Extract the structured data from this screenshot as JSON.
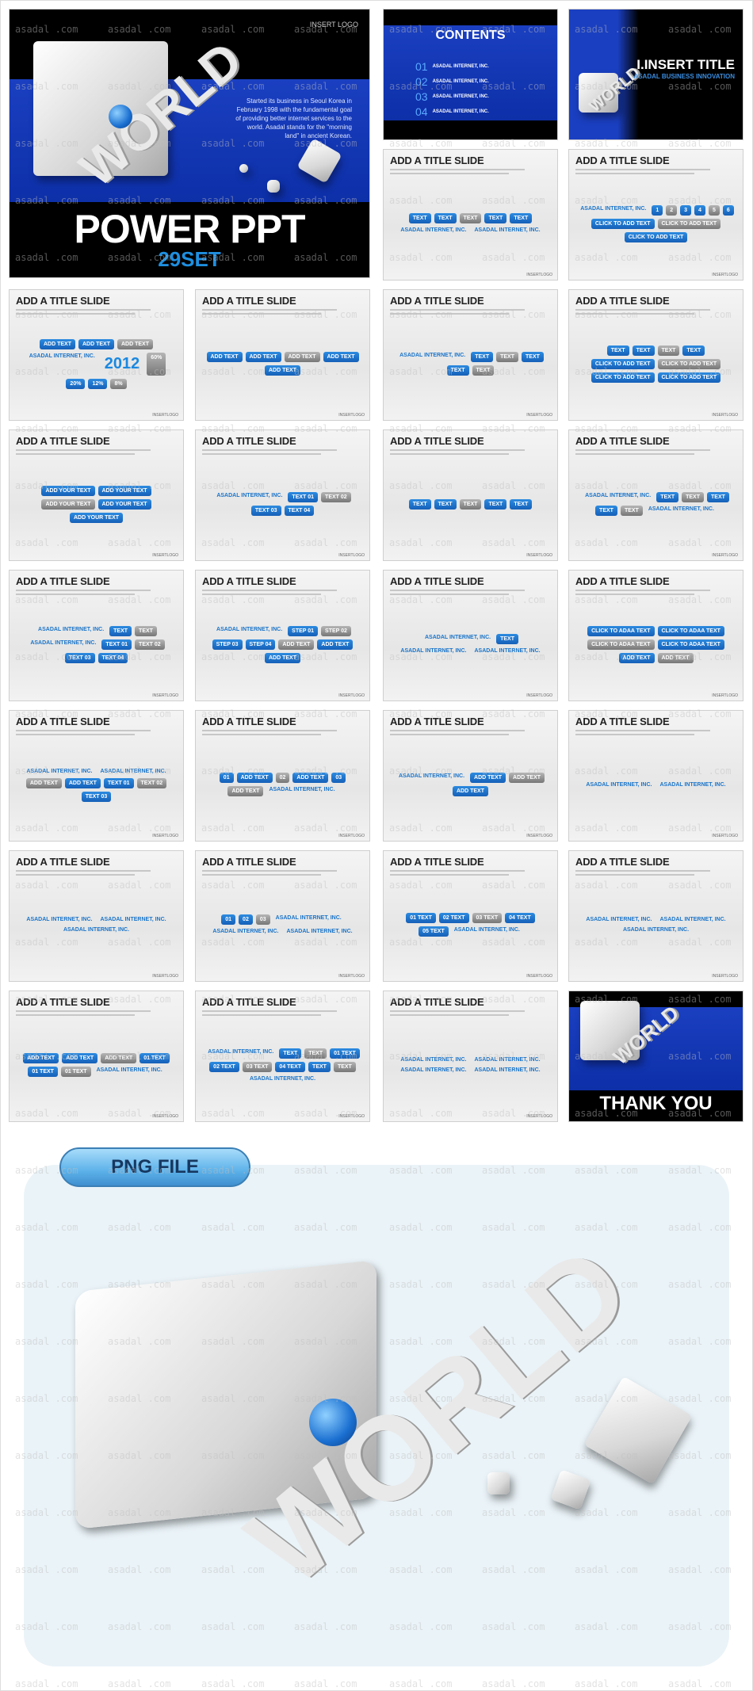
{
  "watermark": "asadal .com",
  "cover": {
    "logo": "INSERT LOGO",
    "world": "WORLD",
    "body": "Started its business in Seoul Korea in February 1998 with the fundamental goal of providing better internet services to the world. Asadal stands for the \"morning land\" in ancient Korean.",
    "title": "POWER PPT",
    "subtitle": "29SET"
  },
  "contents": {
    "title": "CONTENTS",
    "items": [
      {
        "num": "01",
        "label": "ASADAL INTERNET, INC."
      },
      {
        "num": "02",
        "label": "ASADAL INTERNET, INC."
      },
      {
        "num": "03",
        "label": "ASADAL INTERNET, INC."
      },
      {
        "num": "04",
        "label": "ASADAL INTERNET, INC."
      }
    ]
  },
  "section": {
    "title": "I.INSERT TITLE",
    "subtitle": "ASADAL BUSINESS INNOVATION"
  },
  "top_slides": [
    {
      "title": "ADD A TITLE SLIDE",
      "labels": [
        "TEXT",
        "TEXT",
        "TEXT",
        "TEXT",
        "TEXT",
        "ASADAL INTERNET, INC.",
        "ASADAL INTERNET, INC."
      ]
    },
    {
      "title": "ADD A TITLE SLIDE",
      "labels": [
        "ASADAL INTERNET, INC.",
        "1",
        "2",
        "3",
        "4",
        "5",
        "6",
        "CLICK TO ADD TEXT",
        "CLICK TO ADD TEXT",
        "CLICK TO ADD TEXT"
      ]
    }
  ],
  "slides": [
    {
      "title": "ADD A TITLE SLIDE",
      "labels": [
        "ADD TEXT",
        "ADD TEXT",
        "ADD TEXT",
        "ASADAL INTERNET, INC.",
        "2012",
        "60%",
        "20%",
        "12%",
        "8%"
      ]
    },
    {
      "title": "ADD A TITLE SLIDE",
      "labels": [
        "ADD TEXT",
        "ADD TEXT",
        "ADD TEXT",
        "ADD TEXT",
        "ADD TEXT"
      ]
    },
    {
      "title": "ADD A TITLE SLIDE",
      "labels": [
        "ASADAL INTERNET, INC.",
        "TEXT",
        "TEXT",
        "TEXT",
        "TEXT",
        "TEXT"
      ]
    },
    {
      "title": "ADD A TITLE SLIDE",
      "labels": [
        "TEXT",
        "TEXT",
        "TEXT",
        "TEXT",
        "CLICK TO ADD TEXT",
        "CLICK TO ADD TEXT",
        "CLICK TO ADD TEXT",
        "CLICK TO ADD TEXT"
      ]
    },
    {
      "title": "ADD A TITLE SLIDE",
      "labels": [
        "ADD YOUR TEXT",
        "ADD YOUR TEXT",
        "ADD YOUR TEXT",
        "ADD YOUR TEXT",
        "ADD YOUR TEXT"
      ]
    },
    {
      "title": "ADD A TITLE SLIDE",
      "labels": [
        "ASADAL INTERNET, INC.",
        "TEXT 01",
        "TEXT 02",
        "TEXT 03",
        "TEXT 04"
      ]
    },
    {
      "title": "ADD A TITLE SLIDE",
      "labels": [
        "TEXT",
        "TEXT",
        "TEXT",
        "TEXT",
        "TEXT"
      ]
    },
    {
      "title": "ADD A TITLE SLIDE",
      "labels": [
        "ASADAL INTERNET, INC.",
        "TEXT",
        "TEXT",
        "TEXT",
        "TEXT",
        "TEXT",
        "ASADAL INTERNET, INC."
      ]
    },
    {
      "title": "ADD A TITLE SLIDE",
      "labels": [
        "ASADAL INTERNET, INC.",
        "TEXT",
        "TEXT",
        "ASADAL INTERNET, INC.",
        "TEXT 01",
        "TEXT 02",
        "TEXT 03",
        "TEXT 04"
      ]
    },
    {
      "title": "ADD A TITLE SLIDE",
      "labels": [
        "ASADAL INTERNET, INC.",
        "STEP 01",
        "STEP 02",
        "STEP 03",
        "STEP 04",
        "ADD TEXT",
        "ADD TEXT",
        "ADD TEXT"
      ]
    },
    {
      "title": "ADD A TITLE SLIDE",
      "labels": [
        "ASADAL INTERNET, INC.",
        "TEXT",
        "ASADAL INTERNET, INC.",
        "ASADAL INTERNET, INC."
      ]
    },
    {
      "title": "ADD A TITLE SLIDE",
      "labels": [
        "CLICK TO ADAA TEXT",
        "CLICK TO ADAA TEXT",
        "CLICK TO ADAA TEXT",
        "CLICK TO ADAA TEXT",
        "ADD TEXT",
        "ADD TEXT"
      ]
    },
    {
      "title": "ADD A TITLE SLIDE",
      "labels": [
        "ASADAL INTERNET, INC.",
        "ASADAL INTERNET, INC.",
        "ADD TEXT",
        "ADD TEXT",
        "TEXT 01",
        "TEXT 02",
        "TEXT 03"
      ]
    },
    {
      "title": "ADD A TITLE SLIDE",
      "labels": [
        "01",
        "ADD TEXT",
        "02",
        "ADD TEXT",
        "03",
        "ADD TEXT",
        "ASADAL INTERNET, INC."
      ]
    },
    {
      "title": "ADD A TITLE SLIDE",
      "labels": [
        "ASADAL INTERNET, INC.",
        "ADD TEXT",
        "ADD TEXT",
        "ADD TEXT"
      ]
    },
    {
      "title": "ADD A TITLE SLIDE",
      "labels": [
        "ASADAL INTERNET, INC.",
        "ASADAL INTERNET, INC."
      ]
    },
    {
      "title": "ADD A TITLE SLIDE",
      "labels": [
        "ASADAL INTERNET, INC.",
        "ASADAL INTERNET, INC.",
        "ASADAL INTERNET, INC."
      ]
    },
    {
      "title": "ADD A TITLE SLIDE",
      "labels": [
        "01",
        "02",
        "03",
        "ASADAL INTERNET, INC.",
        "ASADAL INTERNET, INC.",
        "ASADAL INTERNET, INC."
      ]
    },
    {
      "title": "ADD A TITLE SLIDE",
      "labels": [
        "01 TEXT",
        "02 TEXT",
        "03 TEXT",
        "04 TEXT",
        "05 TEXT",
        "ASADAL INTERNET, INC."
      ]
    },
    {
      "title": "ADD A TITLE SLIDE",
      "labels": [
        "ASADAL INTERNET, INC.",
        "ASADAL INTERNET, INC.",
        "ASADAL INTERNET, INC."
      ]
    },
    {
      "title": "ADD A TITLE SLIDE",
      "labels": [
        "ADD TEXT",
        "ADD TEXT",
        "ADD TEXT",
        "01 TEXT",
        "01 TEXT",
        "01 TEXT",
        "ASADAL INTERNET, INC."
      ]
    },
    {
      "title": "ADD A TITLE SLIDE",
      "labels": [
        "ASADAL INTERNET, INC.",
        "TEXT",
        "TEXT",
        "01 TEXT",
        "02 TEXT",
        "03 TEXT",
        "04 TEXT",
        "TEXT",
        "TEXT",
        "ASADAL INTERNET, INC."
      ]
    },
    {
      "title": "ADD A TITLE SLIDE",
      "labels": [
        "ASADAL INTERNET, INC.",
        "ASADAL INTERNET, INC.",
        "ASADAL INTERNET, INC.",
        "ASADAL INTERNET, INC."
      ]
    }
  ],
  "thank_you": {
    "title": "THANK YOU",
    "world": "WORLD"
  },
  "footer_logo": "INSERTLOGO",
  "png_section": {
    "label": "PNG FILE",
    "world": "WORLD"
  },
  "colors": {
    "blue": "#1a3fc0",
    "accent": "#1a74c9",
    "pill": "#5db2ea"
  }
}
